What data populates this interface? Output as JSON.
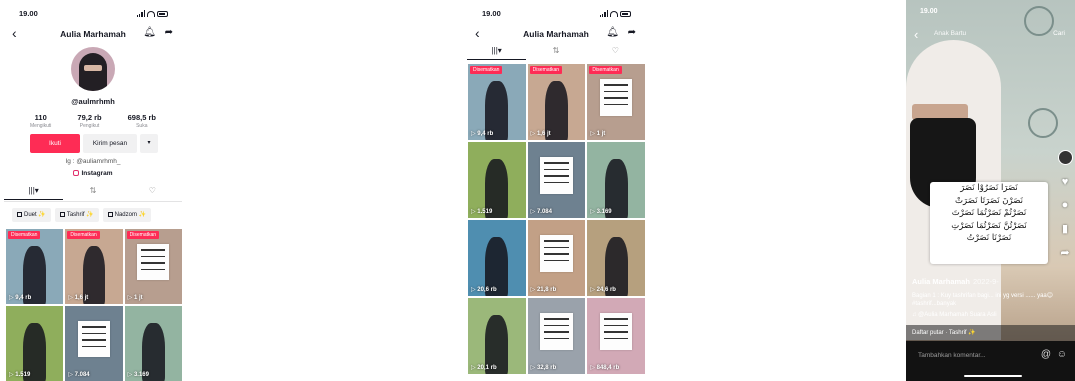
{
  "status_time": "19.00",
  "profile": {
    "title": "Aulia Marhamah",
    "handle": "@aulmrhmh",
    "stats": [
      {
        "value": "110",
        "label": "Mengikuti"
      },
      {
        "value": "79,2 rb",
        "label": "Pengikut"
      },
      {
        "value": "698,5 rb",
        "label": "Suka"
      }
    ],
    "follow_label": "Ikuti",
    "message_label": "Kirim pesan",
    "more_label": "▾",
    "bio": "Ig : @auliamrhmh_",
    "instagram_label": "Instagram",
    "tabs": [
      "|||▾",
      "⇅",
      "♡"
    ],
    "playlists": [
      "Duet ✨",
      "Tashrif ✨",
      "Nadzom ✨"
    ]
  },
  "grid1": [
    {
      "bg": "#8aa9b8",
      "tag": "Disematkan",
      "views": "▷ 9,4 rb",
      "style": "veil"
    },
    {
      "bg": "#c7a892",
      "tag": "Disematkan",
      "views": "▷ 1,6 jt",
      "style": "veil"
    },
    {
      "bg": "#b79e8f",
      "tag": "Disematkan",
      "views": "▷ 1 jt",
      "style": "card"
    },
    {
      "bg": "#8fae5c",
      "tag": "",
      "views": "▷ 1.519",
      "style": "veil"
    },
    {
      "bg": "#6e8190",
      "tag": "",
      "views": "▷ 7.084",
      "style": "card"
    },
    {
      "bg": "#93b4a1",
      "tag": "",
      "views": "▷ 3.169",
      "style": "veil"
    }
  ],
  "grid2": [
    {
      "bg": "#8aa9b8",
      "tag": "Disematkan",
      "views": "▷ 9,4 rb",
      "style": "veil"
    },
    {
      "bg": "#c7a892",
      "tag": "Disematkan",
      "views": "▷ 1,6 jt",
      "style": "veil"
    },
    {
      "bg": "#b79e8f",
      "tag": "Disematkan",
      "views": "▷ 1 jt",
      "style": "card"
    },
    {
      "bg": "#8fae5c",
      "tag": "",
      "views": "▷ 1.519",
      "style": "veil"
    },
    {
      "bg": "#6e8190",
      "tag": "",
      "views": "▷ 7.084",
      "style": "card"
    },
    {
      "bg": "#93b4a1",
      "tag": "",
      "views": "▷ 3.169",
      "style": "veil"
    },
    {
      "bg": "#4f8eb0",
      "tag": "",
      "views": "▷ 20,6 rb",
      "style": "veil"
    },
    {
      "bg": "#c2a086",
      "tag": "",
      "views": "▷ 21,8 rb",
      "style": "card"
    },
    {
      "bg": "#b6a07e",
      "tag": "",
      "views": "▷ 24,6 rb",
      "style": "veil"
    },
    {
      "bg": "#9bb87a",
      "tag": "",
      "views": "▷ 20,1 rb",
      "style": "veil"
    },
    {
      "bg": "#9aa2ab",
      "tag": "",
      "views": "▷ 32,8 rb",
      "style": "card"
    },
    {
      "bg": "#d2a9b6",
      "tag": "",
      "views": "▷ 848,4 rb",
      "style": "card"
    }
  ],
  "video": {
    "song": "Anak Bartu",
    "search": "Cari",
    "username": "Aulia Marhamah",
    "date": "2022-9-",
    "caption": "Bagian 1 : Kuy tashrifan bagi... ini yg versi ...... yaa😊 #tashrif...banyak",
    "music": "♫ @Aulia Marhamah Suara Asli",
    "playlist": "Daftar putar · Tashrif ✨",
    "comment_placeholder": "Tambahkan komentar...",
    "arabic_lines": [
      "نَصَرَا نَصَرُوْا نَصَرَ",
      "نَصَرْنَ نَصَرَتَا نَصَرَتْ",
      "نَصَرْتُمْ نَصَرْتُمَا نَصَرْتَ",
      "نَصَرْتُنَّ نَصَرْتُمَا نَصَرْتِ",
      "نَصَرْنَا نَصَرْتُ"
    ],
    "rail_counts": [
      "9,4",
      "..."
    ]
  }
}
